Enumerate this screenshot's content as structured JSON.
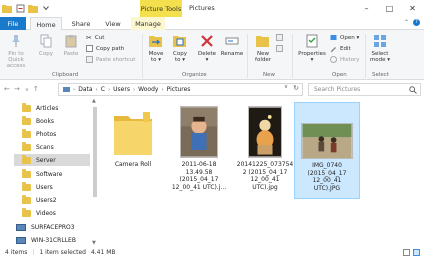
{
  "window": {
    "title": "Pictures",
    "context_tab": "Picture Tools",
    "controls": {
      "minimize": "–",
      "maximize": "□",
      "close": "✕"
    }
  },
  "tabs": {
    "file": "File",
    "home": "Home",
    "share": "Share",
    "view": "View",
    "manage": "Manage"
  },
  "ribbon": {
    "clipboard": {
      "pin": "Pin to Quick\naccess",
      "copy": "Copy",
      "paste": "Paste",
      "cut": "Cut",
      "copy_path": "Copy path",
      "paste_shortcut": "Paste shortcut",
      "label": "Clipboard"
    },
    "organize": {
      "move_to": "Move\nto ▾",
      "copy_to": "Copy\nto ▾",
      "delete": "Delete\n▾",
      "rename": "Rename",
      "label": "Organize"
    },
    "new": {
      "new_folder": "New\nfolder",
      "label": "New"
    },
    "open": {
      "properties": "Properties\n▾",
      "open": "Open ▾",
      "edit": "Edit",
      "history": "History",
      "label": "Open"
    },
    "select": {
      "select_mode": "Select\nmode ▾",
      "label": "Select"
    }
  },
  "address": {
    "crumbs": [
      "Data",
      "C",
      "Users",
      "Woody",
      "Pictures"
    ],
    "search_placeholder": "Search Pictures"
  },
  "nav_items": [
    {
      "label": "Articles",
      "type": "folder"
    },
    {
      "label": "Books",
      "type": "folder"
    },
    {
      "label": "Photos",
      "type": "folder"
    },
    {
      "label": "Scans",
      "type": "folder"
    },
    {
      "label": "Server",
      "type": "folder",
      "selected": true
    },
    {
      "label": "Software",
      "type": "folder"
    },
    {
      "label": "Users",
      "type": "folder"
    },
    {
      "label": "Users2",
      "type": "folder"
    },
    {
      "label": "Videos",
      "type": "folder"
    },
    {
      "label": "SURFACEPRO3",
      "type": "computer"
    },
    {
      "label": "WIN-31CRLLEB",
      "type": "computer"
    }
  ],
  "files": [
    {
      "caption": "Camera Roll",
      "kind": "folder"
    },
    {
      "caption": "2011-06-18\n13.49.58\n(2015_04_17\n12_00_41 UTC).j...",
      "kind": "photo"
    },
    {
      "caption": "20141225_073754\n2 (2015_04_17\n12_00_41\nUTC).jpg",
      "kind": "photo"
    },
    {
      "caption": "IMG_0740\n(2015_04_17\n12_00_41\nUTC).JPG",
      "kind": "photo",
      "selected": true
    }
  ],
  "status": {
    "count": "4 items",
    "selection": "1 item selected",
    "size": "4.41 MB"
  },
  "colors": {
    "accent": "#1979ca",
    "context_tab": "#f4e04d",
    "selection": "#cce8ff",
    "folder": "#e9c24a"
  }
}
